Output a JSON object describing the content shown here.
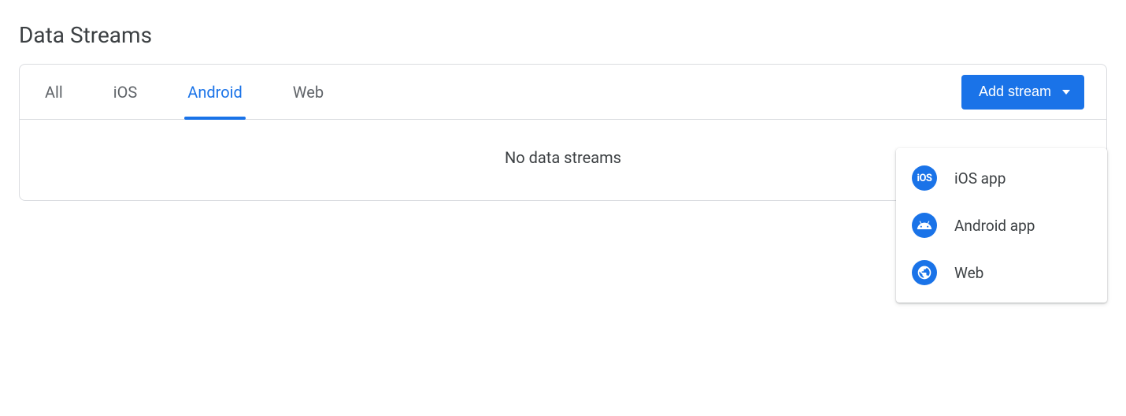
{
  "title": "Data Streams",
  "tabs": [
    {
      "label": "All"
    },
    {
      "label": "iOS"
    },
    {
      "label": "Android"
    },
    {
      "label": "Web"
    }
  ],
  "activeTabIndex": 2,
  "addStreamLabel": "Add stream",
  "emptyState": "No data streams",
  "dropdown": {
    "items": [
      {
        "label": "iOS app",
        "icon": "ios-icon"
      },
      {
        "label": "Android app",
        "icon": "android-icon"
      },
      {
        "label": "Web",
        "icon": "web-icon"
      }
    ]
  }
}
